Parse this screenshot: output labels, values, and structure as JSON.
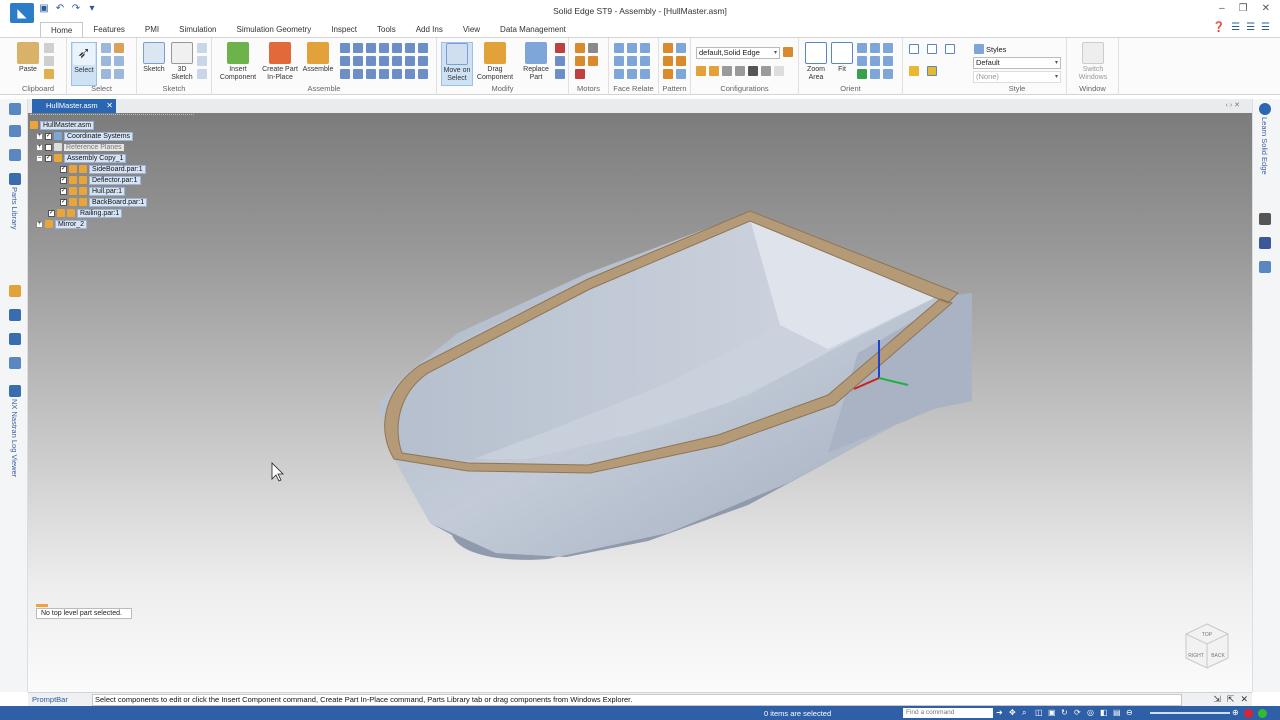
{
  "app": {
    "title": "Solid Edge ST9 - Assembly - [HullMaster.asm]"
  },
  "ribbon_tabs": [
    "Home",
    "Features",
    "PMI",
    "Simulation",
    "Simulation Geometry",
    "Inspect",
    "Tools",
    "Add Ins",
    "View",
    "Data Management"
  ],
  "ribbon": {
    "clipboard": {
      "paste": "Paste",
      "group": "Clipboard"
    },
    "select": {
      "select": "Select",
      "group": "Select"
    },
    "sketch": {
      "sketch": "Sketch",
      "sketch3d": "3D Sketch",
      "group": "Sketch"
    },
    "assemble": {
      "insert": "Insert Component",
      "create": "Create Part In-Place",
      "assemble": "Assemble",
      "group": "Assemble"
    },
    "modify": {
      "move": "Move on Select",
      "drag": "Drag Component",
      "replace": "Replace Part",
      "group": "Modify"
    },
    "motors": {
      "group": "Motors"
    },
    "face_relate": {
      "group": "Face Relate"
    },
    "pattern": {
      "group": "Pattern"
    },
    "configurations": {
      "value": "default,Solid Edge",
      "group": "Configurations"
    },
    "orient": {
      "zoom": "Zoom Area",
      "fit": "Fit",
      "group": "Orient"
    },
    "style": {
      "styles": "Styles",
      "value": "Default",
      "none": "(None)",
      "group": "Style"
    },
    "window": {
      "switch": "Switch Windows",
      "group": "Window"
    }
  },
  "document_tab": "HullMaster.asm",
  "left_sidebar": {
    "parts_library": "Parts Library",
    "nastran": "NX Nastran Log Viewer"
  },
  "right_sidebar": {
    "learn": "Learn Solid Edge"
  },
  "tree": {
    "root": "HullMaster.asm",
    "items": [
      {
        "label": "Coordinate Systems"
      },
      {
        "label": "Reference Planes"
      },
      {
        "label": "Assembly Copy_1"
      },
      {
        "label": "SideBoard.par:1"
      },
      {
        "label": "Deflector.par:1"
      },
      {
        "label": "Hull.par:1"
      },
      {
        "label": "BackBoard.par:1"
      },
      {
        "label": "Railing.par:1"
      },
      {
        "label": "Mirror_2"
      }
    ]
  },
  "viewport": {
    "status": "No top level part selected."
  },
  "navcube": {
    "top": "TOP",
    "right": "RIGHT",
    "back": "BACK"
  },
  "prompt": {
    "label": "PromptBar",
    "text": "Select components to edit or click the Insert Component command, Create Part In-Place command, Parts Library tab or drag components from Windows Explorer."
  },
  "statusbar": {
    "items": "0 items are selected",
    "find_placeholder": "Find a command"
  },
  "colors": {
    "accent": "#2b66b3",
    "status_bar": "#2f5fa6",
    "model": "#b9c3d2",
    "rim": "#b59a78"
  }
}
